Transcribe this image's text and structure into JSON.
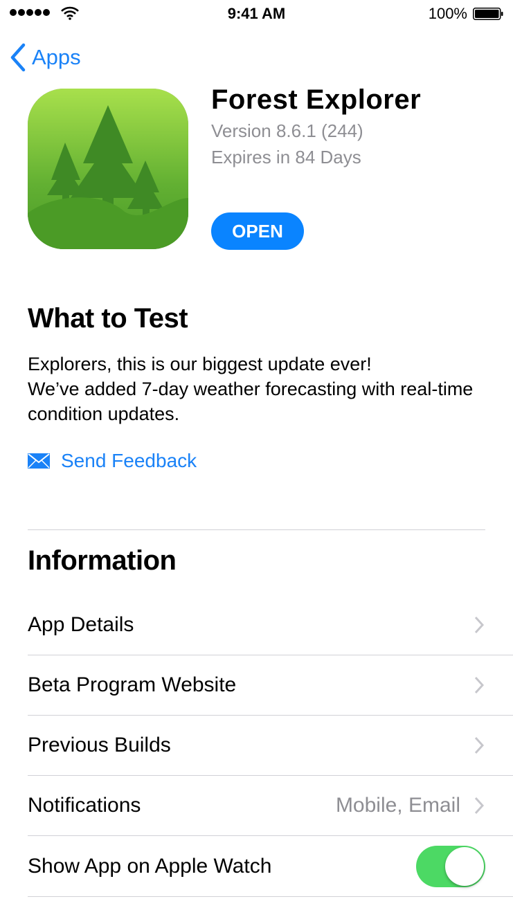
{
  "status_bar": {
    "time": "9:41 AM",
    "battery_percent": "100%",
    "signal_bars": 5,
    "battery_level": 1.0
  },
  "nav": {
    "back_label": "Apps",
    "back_icon": "chevron-left-icon"
  },
  "app": {
    "name": "Forest Explorer",
    "version": "Version 8.6.1 (244)",
    "expires": "Expires in 84 Days",
    "open_label": "OPEN",
    "icon": "forest-trees-icon"
  },
  "what_to_test": {
    "title": "What to Test",
    "description": "Explorers, this is our biggest update ever!\nWe’ve added 7-day weather forecasting with real-time condition updates.",
    "feedback_label": "Send Feedback",
    "feedback_icon": "envelope-icon"
  },
  "information": {
    "title": "Information",
    "rows": [
      {
        "label": "App Details",
        "value": "",
        "type": "link"
      },
      {
        "label": "Beta Program Website",
        "value": "",
        "type": "link"
      },
      {
        "label": "Previous Builds",
        "value": "",
        "type": "link"
      },
      {
        "label": "Notifications",
        "value": "Mobile, Email",
        "type": "link"
      },
      {
        "label": "Show App on Apple Watch",
        "value": "",
        "type": "toggle",
        "on": true
      }
    ]
  },
  "colors": {
    "accent": "#1a82f7",
    "button": "#0a84ff",
    "toggle_on": "#4cd964",
    "secondary_text": "#8e8e93",
    "danger": "#ff3b30"
  }
}
